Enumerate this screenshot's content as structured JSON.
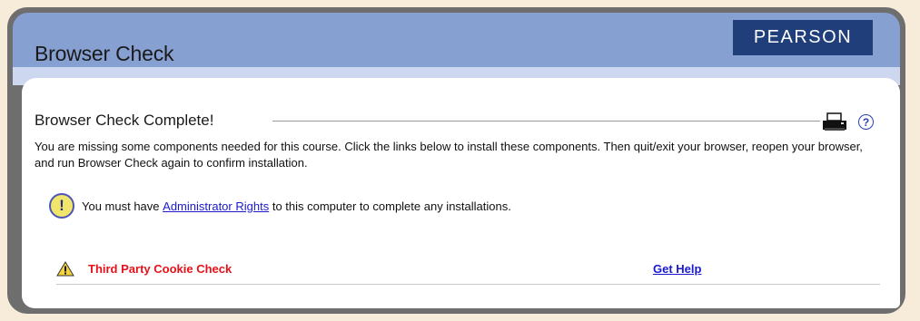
{
  "header": {
    "title": "Browser Check",
    "logo_text": "PEARSON"
  },
  "main": {
    "heading": "Browser Check Complete!",
    "description": "You are missing some components needed for this course. Click the links below to install these components. Then quit/exit your browser, reopen your browser, and run Browser Check again to confirm installation.",
    "notice": {
      "prefix": "You must have ",
      "link": "Administrator Rights",
      "suffix": " to this computer to complete any installations."
    },
    "checks": [
      {
        "label": "Third Party Cookie Check",
        "link": "Get Help"
      }
    ]
  },
  "icons": {
    "print": "printer-icon",
    "help": "help-icon",
    "notice": "exclamation-circle-icon",
    "warning": "warning-triangle-icon"
  },
  "colors": {
    "header_bg": "#87a0d2",
    "logo_bg": "#1f3e7a",
    "frame": "#6e6e6e",
    "page_bg": "#f7ebd9",
    "error_text": "#e8111a",
    "link": "#1a1acc"
  }
}
